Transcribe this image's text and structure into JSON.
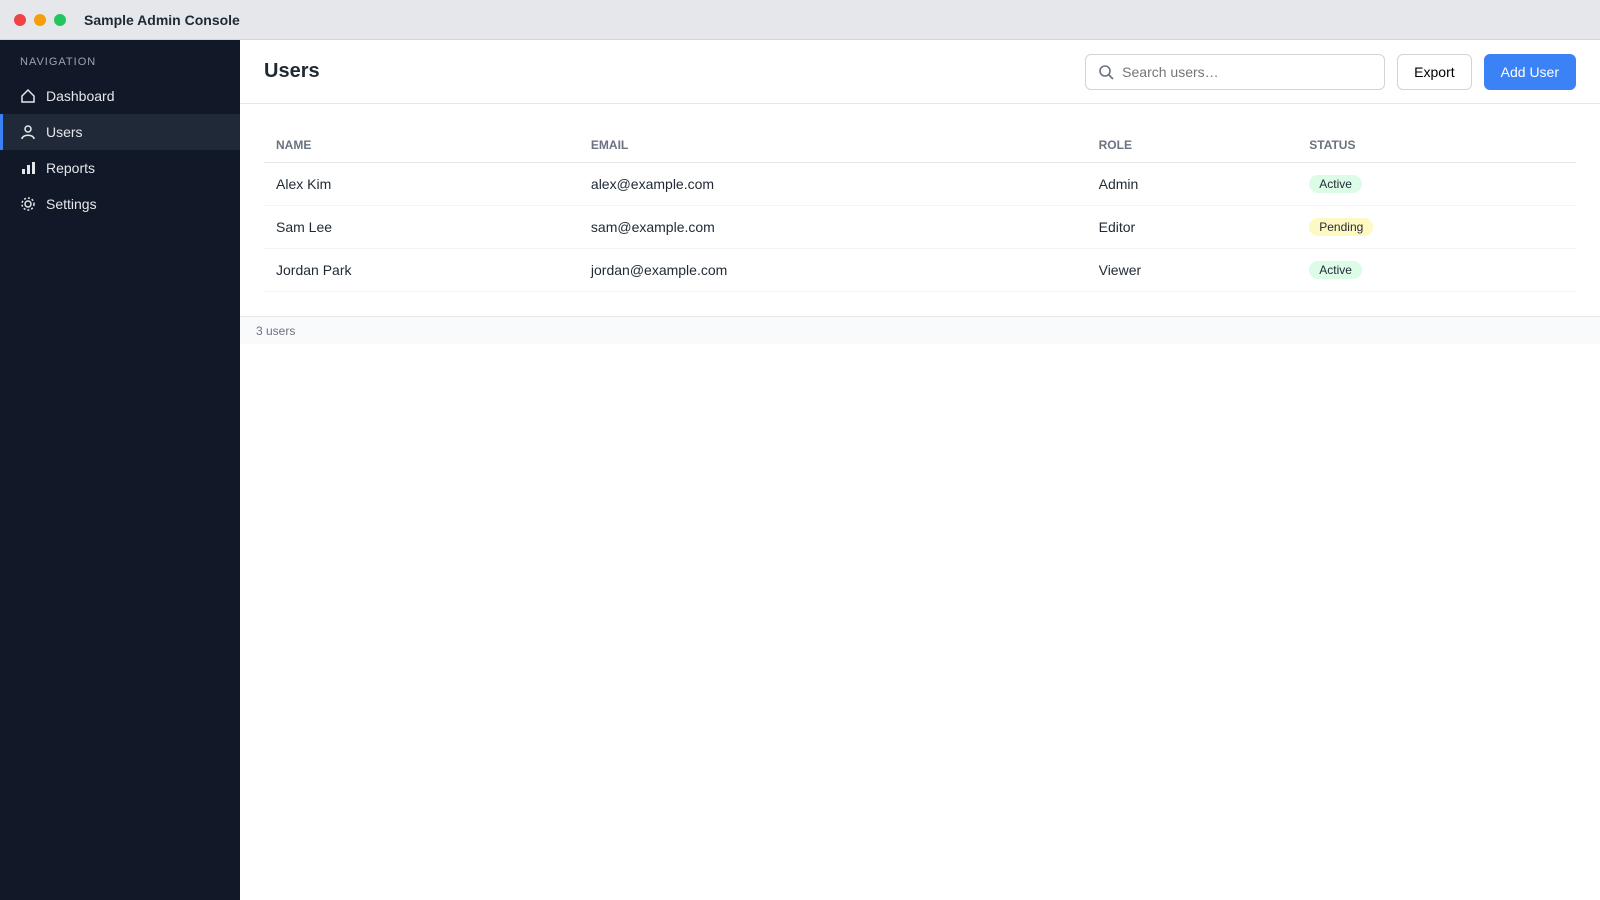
{
  "app": {
    "title": "Sample Admin Console"
  },
  "sidebar": {
    "heading": "Navigation",
    "items": [
      {
        "label": "Dashboard",
        "icon": "home-icon",
        "active": false
      },
      {
        "label": "Users",
        "icon": "users-icon",
        "active": true
      },
      {
        "label": "Reports",
        "icon": "chart-icon",
        "active": false
      },
      {
        "label": "Settings",
        "icon": "gear-icon",
        "active": false
      }
    ]
  },
  "toolbar": {
    "title": "Users",
    "search_placeholder": "Search users…",
    "search_value": "",
    "export_label": "Export",
    "add_label": "Add User"
  },
  "table": {
    "columns": [
      "Name",
      "Email",
      "Role",
      "Status"
    ],
    "rows": [
      {
        "name": "Alex Kim",
        "email": "alex@example.com",
        "role": "Admin",
        "status": "Active",
        "status_color": "#dcfce7"
      },
      {
        "name": "Sam Lee",
        "email": "sam@example.com",
        "role": "Editor",
        "status": "Pending",
        "status_color": "#fef9c3"
      },
      {
        "name": "Jordan Park",
        "email": "jordan@example.com",
        "role": "Viewer",
        "status": "Active",
        "status_color": "#dcfce7"
      }
    ]
  },
  "statusbar": {
    "text": "3 users"
  },
  "colors": {
    "accent": "#3b82f6"
  }
}
